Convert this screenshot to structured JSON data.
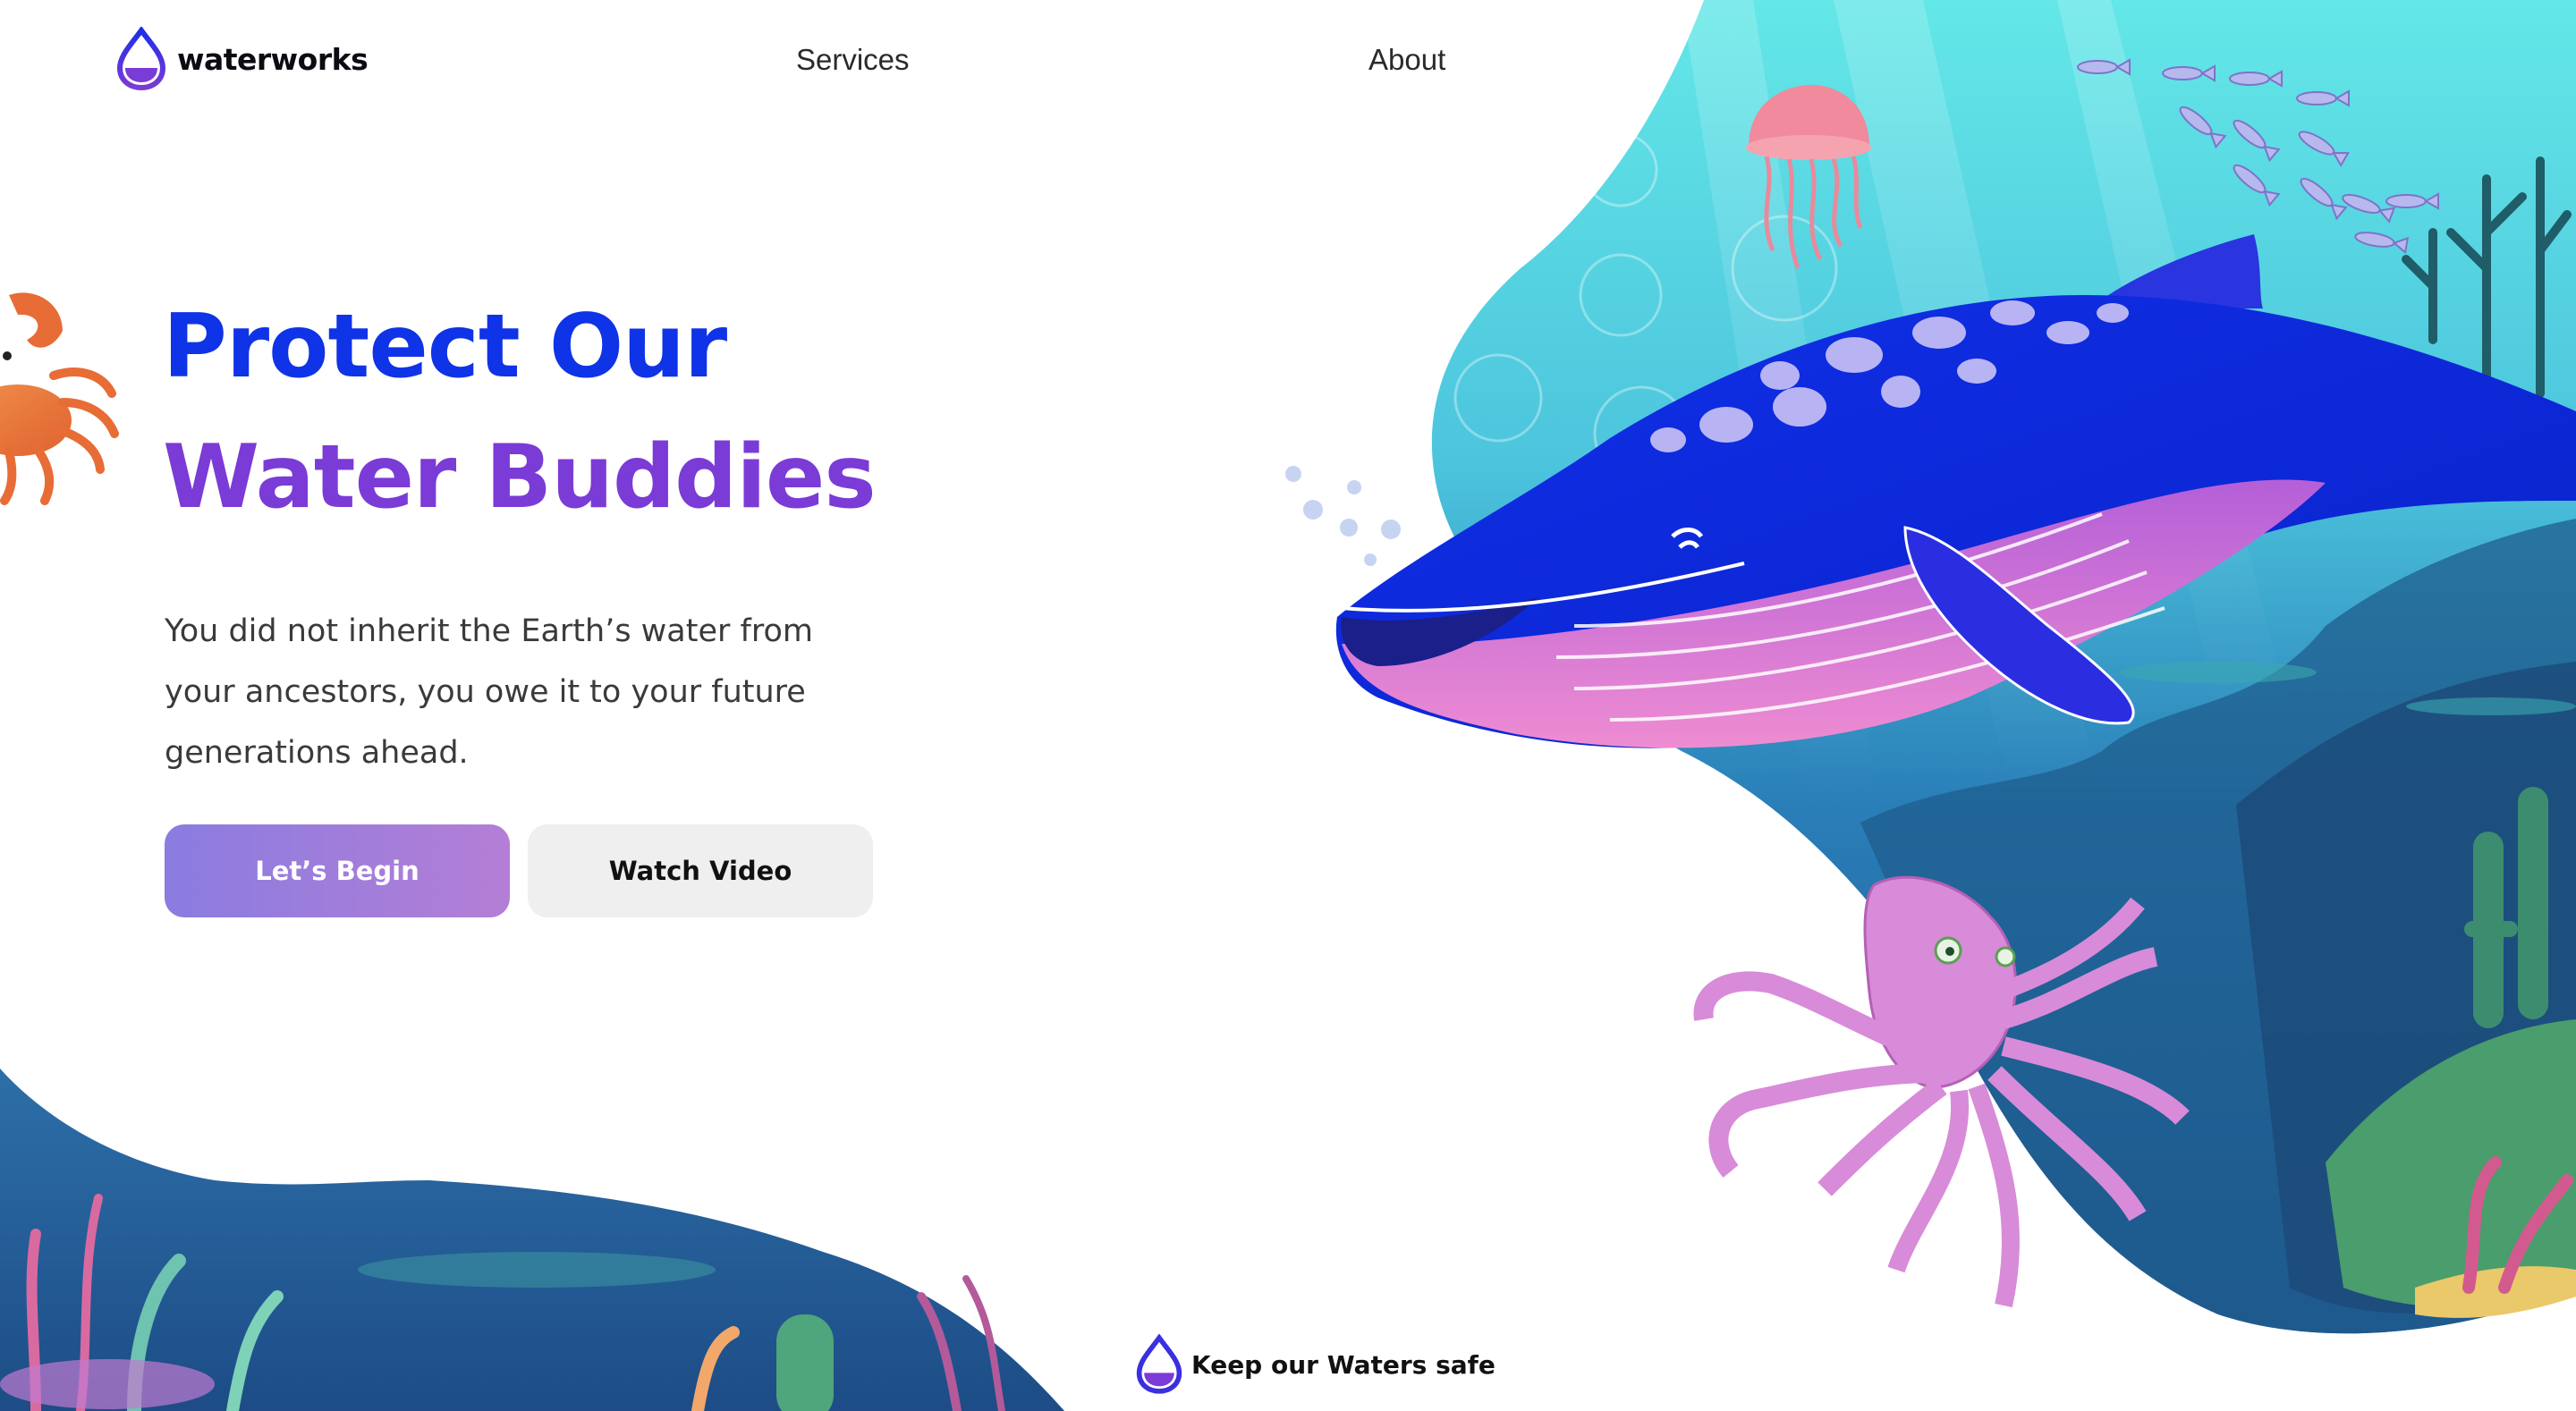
{
  "brand": {
    "name": "waterworks",
    "logo_icon": "water-drop-icon"
  },
  "nav": {
    "services": "Services",
    "about": "About"
  },
  "hero": {
    "title_line1": "Protect Our",
    "title_line2": "Water Buddies",
    "description": "You did not inherit the Earth’s water from your ancestors, you owe it to your future generations ahead.",
    "primary_button": "Let’s Begin",
    "secondary_button": "Watch Video"
  },
  "footer": {
    "tagline": "Keep our Waters safe",
    "icon": "water-drop-icon"
  },
  "colors": {
    "title_blue": "#0f33e6",
    "title_purple": "#7b3bd6",
    "button_gradient_start": "#8a7ce0",
    "button_gradient_end": "#b47ed6",
    "secondary_button_bg": "#efefef",
    "ocean_top": "#5ee4e6",
    "ocean_deep": "#1b5aa6",
    "whale_blue": "#0c2de8",
    "octopus_pink": "#d88bd9"
  }
}
